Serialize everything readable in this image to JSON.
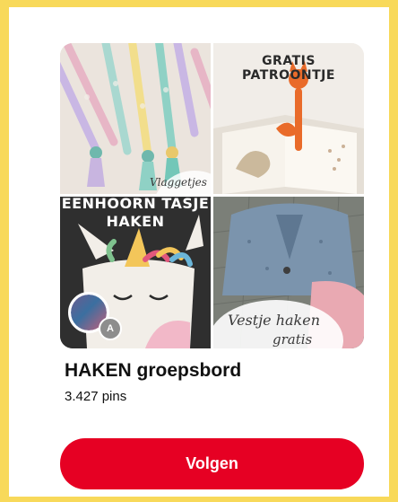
{
  "board": {
    "title": "HAKEN groepsbord",
    "pin_count": "3.427 pins",
    "follow_label": "Volgen",
    "avatar_letter": "A"
  },
  "tiles": [
    {
      "name": "tile-bookmarks",
      "caption": "Vlaggetjes"
    },
    {
      "name": "tile-fox-bookmark",
      "caption": "GRATIS PATROONTJE"
    },
    {
      "name": "tile-unicorn-bag",
      "caption_line1": "EENHOORN TASJE",
      "caption_line2": "HAKEN"
    },
    {
      "name": "tile-vest",
      "caption_line1": "Vestje haken",
      "caption_line2": "gratis"
    }
  ],
  "colors": {
    "frame": "#f8d95a",
    "button": "#e60023",
    "button_text": "#ffffff"
  }
}
